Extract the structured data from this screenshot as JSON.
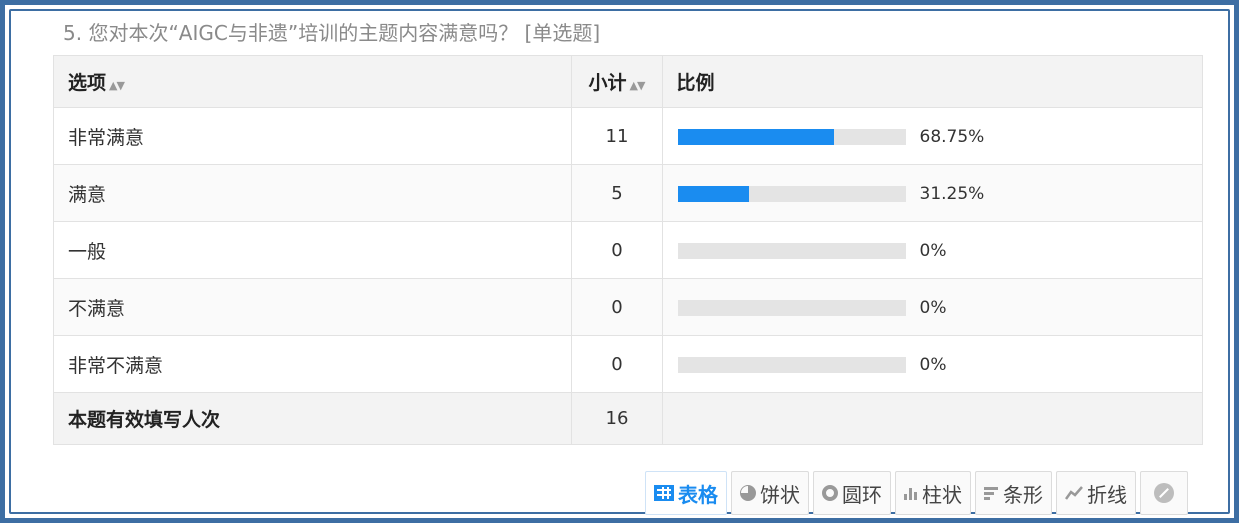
{
  "question": {
    "title": "5. 您对本次“AIGC与非遗”培训的主题内容满意吗？ [单选题]"
  },
  "table": {
    "headers": {
      "option": "选项",
      "count": "小计",
      "ratio": "比例",
      "sort_icon": "sort-icon"
    },
    "rows": [
      {
        "option": "非常满意",
        "count": "11",
        "percent": "68.75%",
        "fraction": 0.6875
      },
      {
        "option": "满意",
        "count": "5",
        "percent": "31.25%",
        "fraction": 0.3125
      },
      {
        "option": "一般",
        "count": "0",
        "percent": "0%",
        "fraction": 0
      },
      {
        "option": "不满意",
        "count": "0",
        "percent": "0%",
        "fraction": 0
      },
      {
        "option": "非常不满意",
        "count": "0",
        "percent": "0%",
        "fraction": 0
      }
    ],
    "total": {
      "label": "本题有效填写人次",
      "count": "16"
    }
  },
  "toolbar": {
    "buttons": [
      {
        "label": "表格",
        "icon": "table-icon",
        "active": true
      },
      {
        "label": "饼状",
        "icon": "pie-icon",
        "active": false
      },
      {
        "label": "圆环",
        "icon": "ring-icon",
        "active": false
      },
      {
        "label": "柱状",
        "icon": "column-icon",
        "active": false
      },
      {
        "label": "条形",
        "icon": "bar-icon",
        "active": false
      },
      {
        "label": "折线",
        "icon": "line-icon",
        "active": false
      }
    ],
    "disabled_icon": "ban-icon"
  },
  "colors": {
    "accent": "#1a8cf0",
    "bar_track": "#e4e4e4",
    "frame": "#3d6ea3"
  }
}
